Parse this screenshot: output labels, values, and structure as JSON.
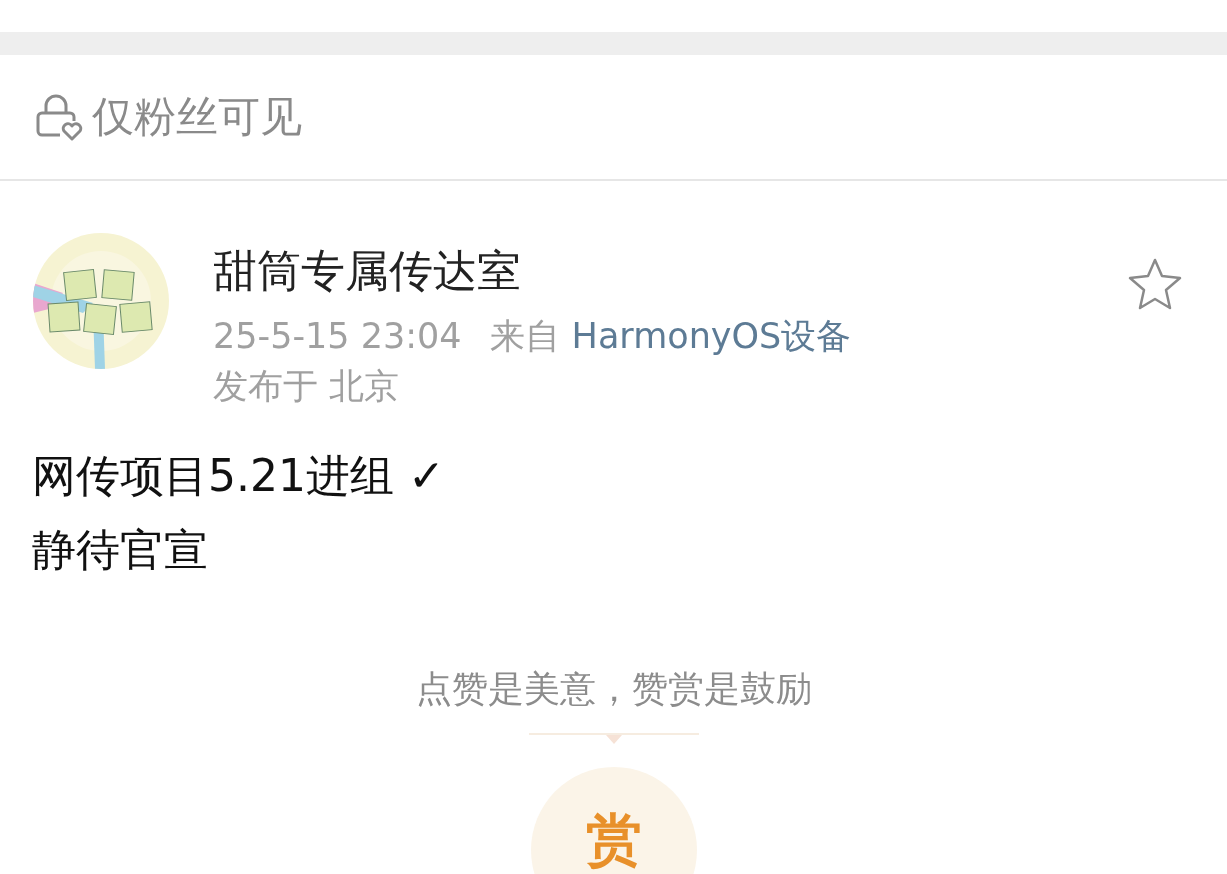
{
  "visibility": {
    "label": "仅粉丝可见"
  },
  "post": {
    "author": "甜筒专属传达室",
    "favorited": false,
    "time": "25-5-15 23:04",
    "source_prefix": "来自",
    "source": "HarmonyOS设备",
    "location": "发布于 北京",
    "lines": [
      "网传项目5.21进组 ✓",
      "静待官宣"
    ]
  },
  "reward": {
    "slogan": "点赞是美意，赞赏是鼓励",
    "button": "赏"
  }
}
